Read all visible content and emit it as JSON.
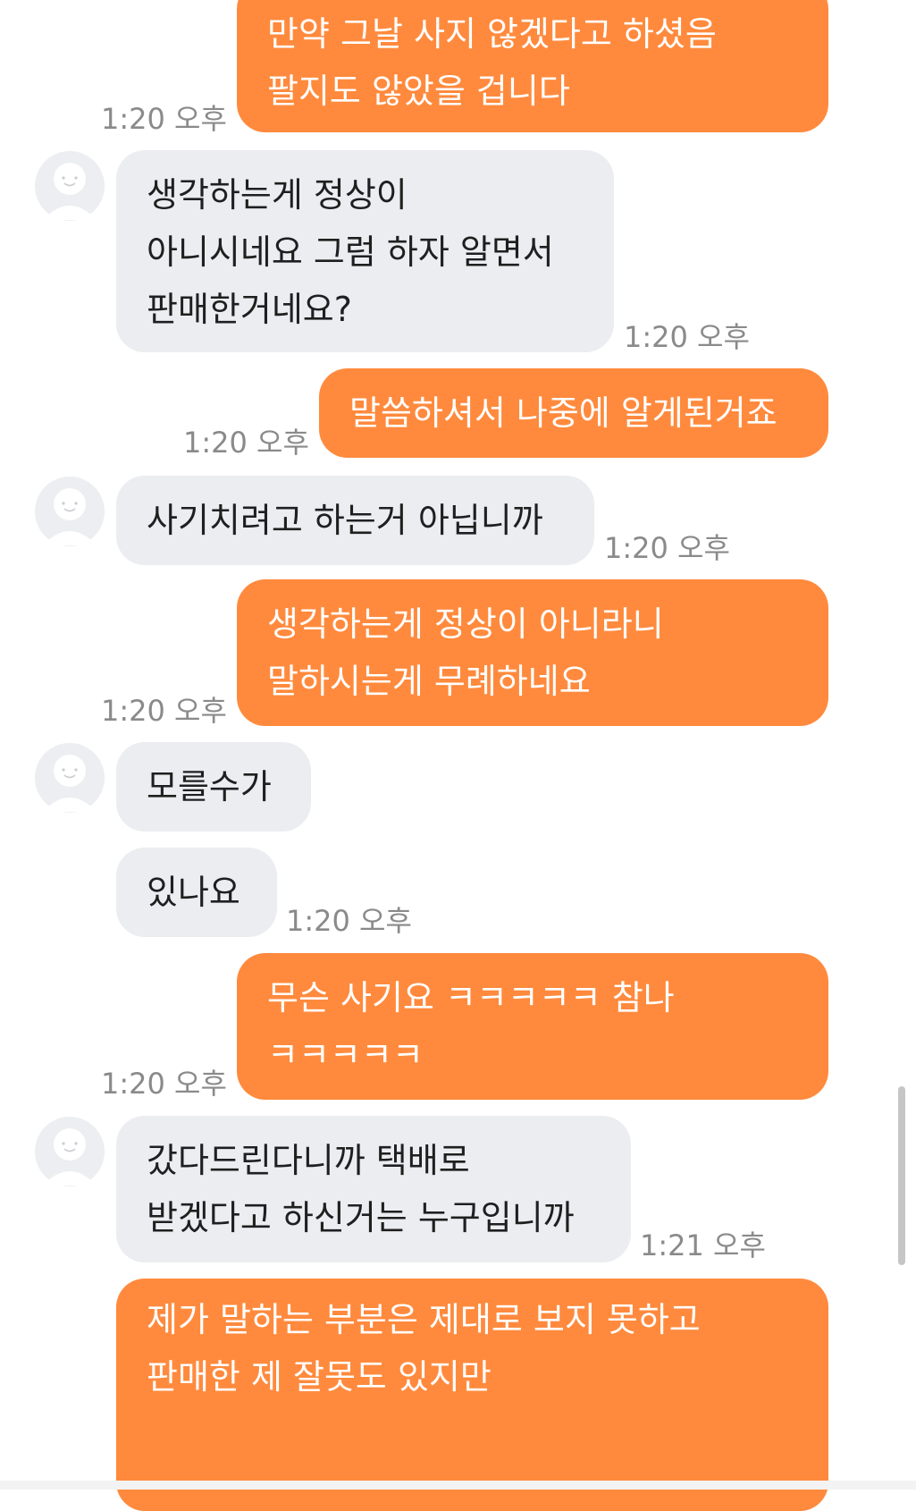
{
  "messages": [
    {
      "side": "me",
      "text": "만약 그날 사지 않겠다고 하셨음\n팔지도 않았을 겁니다",
      "time": "1:20 오후"
    },
    {
      "side": "them",
      "text": "생각하는게 정상이\n아니시네요 그럼 하자 알면서\n판매한거네요?",
      "time": "1:20 오후"
    },
    {
      "side": "me",
      "text": "말씀하셔서 나중에 알게된거죠",
      "time": "1:20 오후"
    },
    {
      "side": "them",
      "text": "사기치려고 하는거 아닙니까",
      "time": "1:20 오후"
    },
    {
      "side": "me",
      "text": "생각하는게 정상이 아니라니\n말하시는게 무례하네요",
      "time": "1:20 오후"
    },
    {
      "side": "them",
      "text": "모를수가",
      "time": ""
    },
    {
      "side": "them",
      "text": "있나요",
      "time": "1:20 오후"
    },
    {
      "side": "me",
      "text": "무슨 사기요 ㅋㅋㅋㅋㅋ 참나\nㅋㅋㅋㅋㅋ",
      "time": "1:20 오후"
    },
    {
      "side": "them",
      "text": "갔다드린다니까 택배로\n받겠다고 하신거는 누구입니까",
      "time": "1:21 오후"
    },
    {
      "side": "me",
      "text": "제가 말하는 부분은 제대로 보지 못하고\n판매한 제 잘못도 있지만",
      "time": ""
    }
  ],
  "icons": {
    "avatar": "default-avatar-icon"
  },
  "colors": {
    "my_bubble": "#ff8a3d",
    "their_bubble": "#ebedf0",
    "timestamp": "#8a8a8a"
  }
}
